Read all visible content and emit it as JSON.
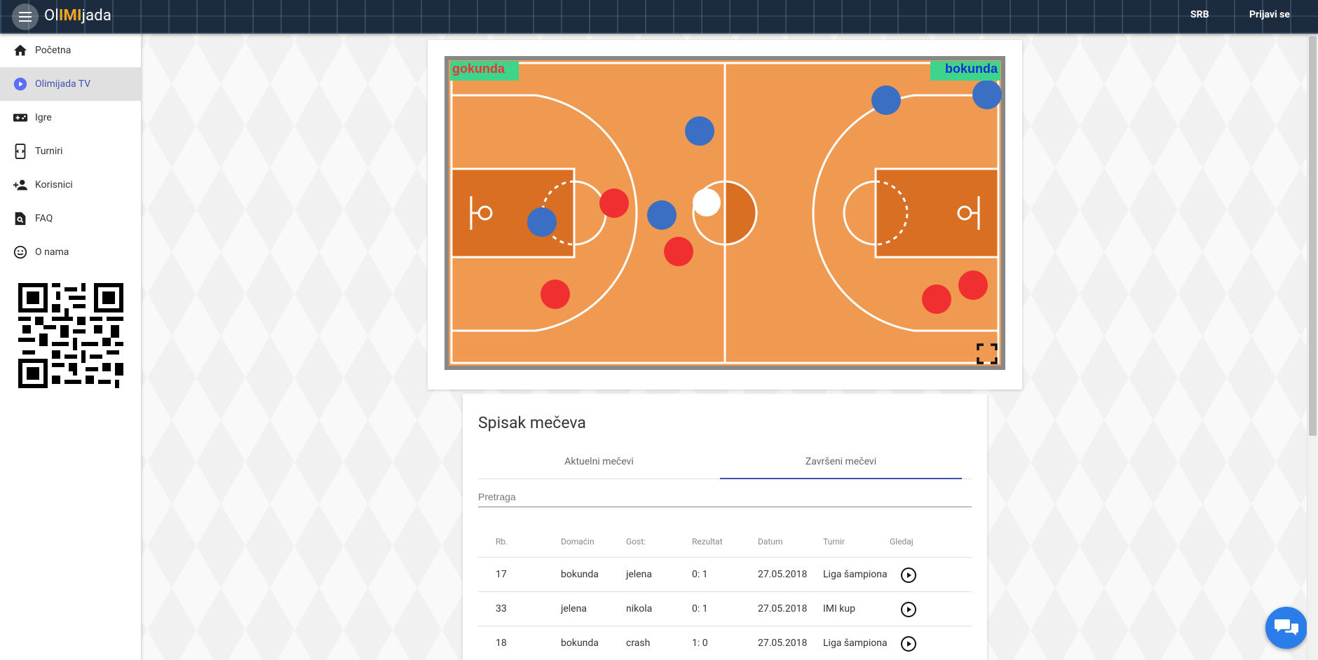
{
  "header": {
    "logo_prefix": "Ol",
    "logo_highlight": "IMI",
    "logo_suffix": "jada",
    "language": "SRB",
    "login": "Prijavi se"
  },
  "sidebar": {
    "items": [
      {
        "label": "Početna",
        "icon": "home-icon"
      },
      {
        "label": "Olimijada TV",
        "icon": "play-circle-icon",
        "active": true
      },
      {
        "label": "Igre",
        "icon": "gamepad-icon"
      },
      {
        "label": "Turniri",
        "icon": "tournament-icon"
      },
      {
        "label": "Korisnici",
        "icon": "add-user-icon"
      },
      {
        "label": "FAQ",
        "icon": "search-page-icon"
      },
      {
        "label": "O nama",
        "icon": "smiley-icon"
      }
    ]
  },
  "game": {
    "home_team": "gokunda",
    "away_team": "bokunda",
    "home_color": "#e33333",
    "away_color": "#1a2fcf",
    "court_color": "#ef9a50"
  },
  "matches": {
    "title": "Spisak mečeva",
    "tabs": [
      {
        "label": "Aktuelni mečevi",
        "active": false
      },
      {
        "label": "Završeni mečevi",
        "active": true
      }
    ],
    "search_placeholder": "Pretraga",
    "columns": [
      "Rb.",
      "Domaćin",
      "Gost:",
      "Rezultat",
      "Datum",
      "Turnir",
      "Gledaj"
    ],
    "rows": [
      {
        "rb": "17",
        "home": "bokunda",
        "guest": "jelena",
        "score": "0: 1",
        "date": "27.05.2018",
        "tournament": "Liga šampiona"
      },
      {
        "rb": "33",
        "home": "jelena",
        "guest": "nikola",
        "score": "0: 1",
        "date": "27.05.2018",
        "tournament": "IMI kup"
      },
      {
        "rb": "18",
        "home": "bokunda",
        "guest": "crash",
        "score": "1: 0",
        "date": "27.05.2018",
        "tournament": "Liga šampiona"
      }
    ]
  }
}
